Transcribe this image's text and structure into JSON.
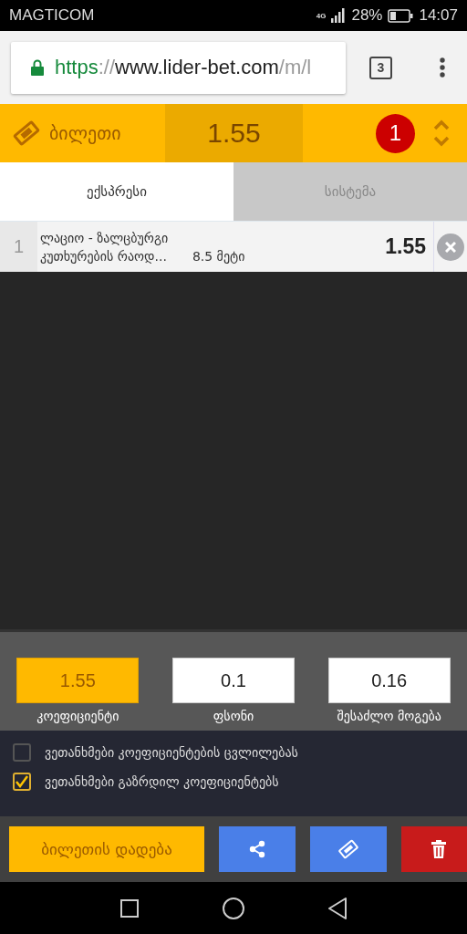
{
  "status_bar": {
    "carrier": "MAGTICOM",
    "network": "4G",
    "battery": "28%",
    "time": "14:07"
  },
  "browser": {
    "url_scheme": "https",
    "url_sep": "://",
    "url_host": "www.lider-bet.com",
    "url_path": "/m/l",
    "tab_count": "3"
  },
  "ticket_header": {
    "title": "ბილეთი",
    "odds": "1.55",
    "count": "1"
  },
  "tabs": [
    {
      "label": "ექსპრესი",
      "selected": true
    },
    {
      "label": "სისტემა",
      "selected": false
    }
  ],
  "bets": [
    {
      "number": "1",
      "match": "ლაციო - ზალცბურგი",
      "market": "კუთხურების რაოდ...",
      "pick": "8.5 მეტი",
      "odds": "1.55"
    }
  ],
  "summary": [
    {
      "value": "1.55",
      "label": "კოეფიციენტი",
      "highlighted": true
    },
    {
      "value": "0.1",
      "label": "ფსონი",
      "highlighted": false
    },
    {
      "value": "0.16",
      "label": "შესაძლო მოგება",
      "highlighted": false
    }
  ],
  "options": [
    {
      "label": "ვეთანხმები კოეფიციენტების ცვლილებას",
      "checked": false
    },
    {
      "label": "ვეთანხმები გაზრდილ კოეფიციენტებს",
      "checked": true
    }
  ],
  "actions": [
    {
      "kind": "place",
      "label": "ბილეთის დადება"
    },
    {
      "kind": "share"
    },
    {
      "kind": "ticket"
    },
    {
      "kind": "delete"
    }
  ]
}
